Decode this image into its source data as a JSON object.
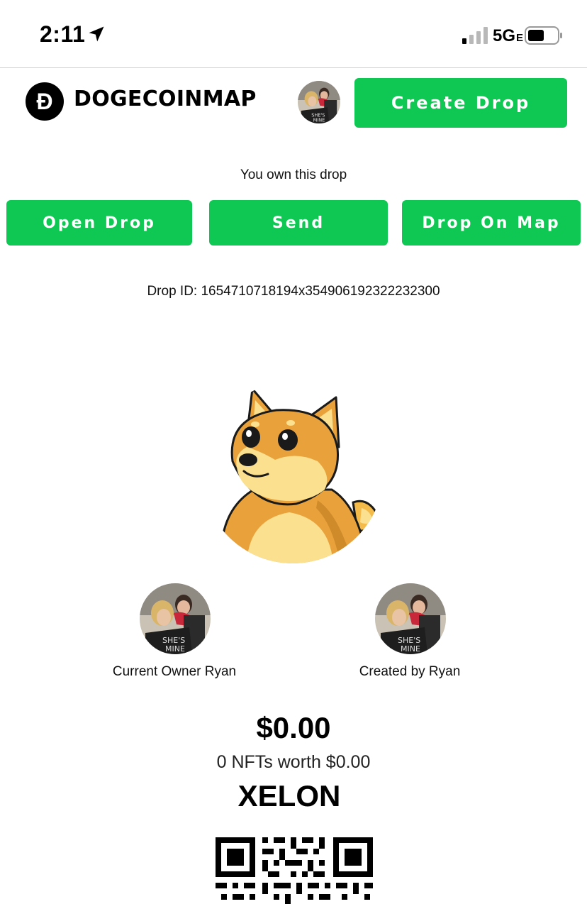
{
  "status_bar": {
    "time": "2:11",
    "network": "5G",
    "network_sub": "E",
    "icons": [
      "location-arrow-icon",
      "signal-bars-icon",
      "battery-icon"
    ]
  },
  "header": {
    "brand_logo_glyph": "Ð",
    "brand_name": "DOGECOINMAP",
    "create_button": "Create Drop"
  },
  "drop": {
    "ownership_text": "You own this drop",
    "actions": {
      "open": "Open Drop",
      "send": "Send",
      "map": "Drop On Map"
    },
    "id_text": "Drop ID: 1654710718194x354906192322232300",
    "owner_label": "Current Owner Ryan",
    "creator_label": "Created by Ryan",
    "price": "$0.00",
    "worth": "0 NFTs worth $0.00",
    "name": "XELON"
  },
  "colors": {
    "accent_green": "#0ec853",
    "doge_orange": "#e9a23b",
    "doge_cream": "#fbe08f"
  }
}
